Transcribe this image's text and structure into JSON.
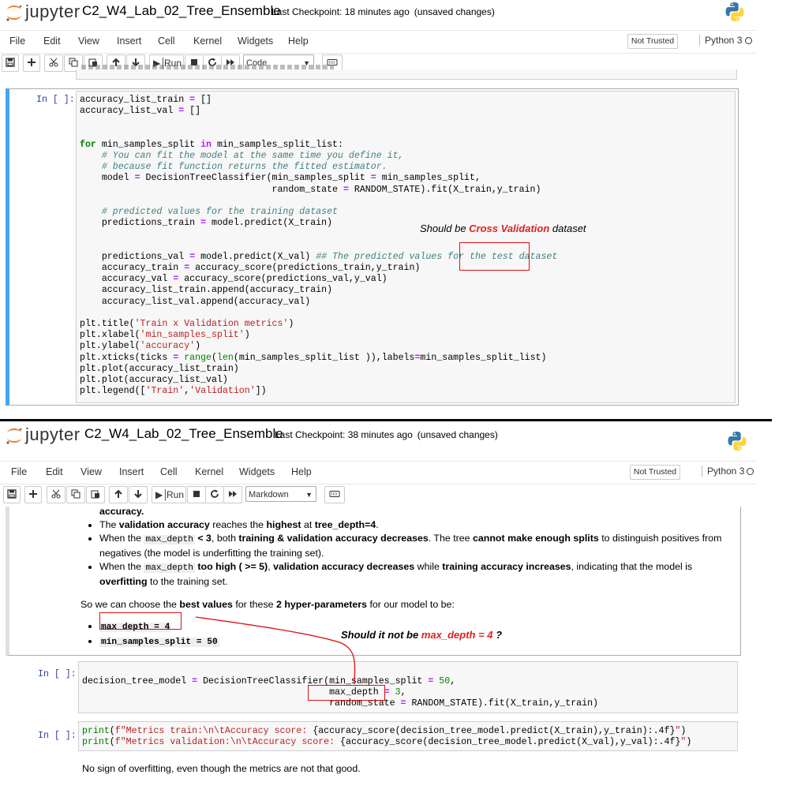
{
  "brand": "jupyter",
  "menu_items": [
    "File",
    "Edit",
    "View",
    "Insert",
    "Cell",
    "Kernel",
    "Widgets",
    "Help"
  ],
  "not_trusted": "Not Trusted",
  "kernel_name": "Python 3",
  "run_label": "Run",
  "unsaved": "(unsaved changes)",
  "colors": {
    "cell_border": "#cfcfcf",
    "selected_bar": "#42a5f5",
    "prompt": "#303f9f",
    "annotation_red": "#e02020"
  },
  "top": {
    "notebook_title": "C2_W4_Lab_02_Tree_Ensemble",
    "checkpoint": "Last Checkpoint: 18 minutes ago",
    "cell_type": "Code",
    "prompt": "In [ ]:",
    "annotation_prefix": "Should be ",
    "annotation_red": "Cross Validation",
    "annotation_suffix": " dataset"
  },
  "bottom": {
    "notebook_title": "C2_W4_Lab_02_Tree_Ensemble",
    "checkpoint": "Last Checkpoint: 38 minutes ago",
    "cell_type": "Markdown",
    "prompt1": "In [ ]:",
    "prompt2": "In [ ]:",
    "annotation_prefix": "Should it not be ",
    "annotation_red": "max_depth = 4",
    "annotation_suffix": " ?",
    "md_bullet0": "accuracy.",
    "md_choose_text_1": "So we can choose the ",
    "md_choose_text_2": "best values",
    "md_choose_text_3": " for these ",
    "md_choose_text_4": "2 hyper-parameters",
    "md_choose_text_5": " for our model to be:",
    "param1": "max_depth = 4",
    "param2": "min_samples_split = 50",
    "last_text": "No sign of overfitting, even though the metrics are not that good."
  }
}
